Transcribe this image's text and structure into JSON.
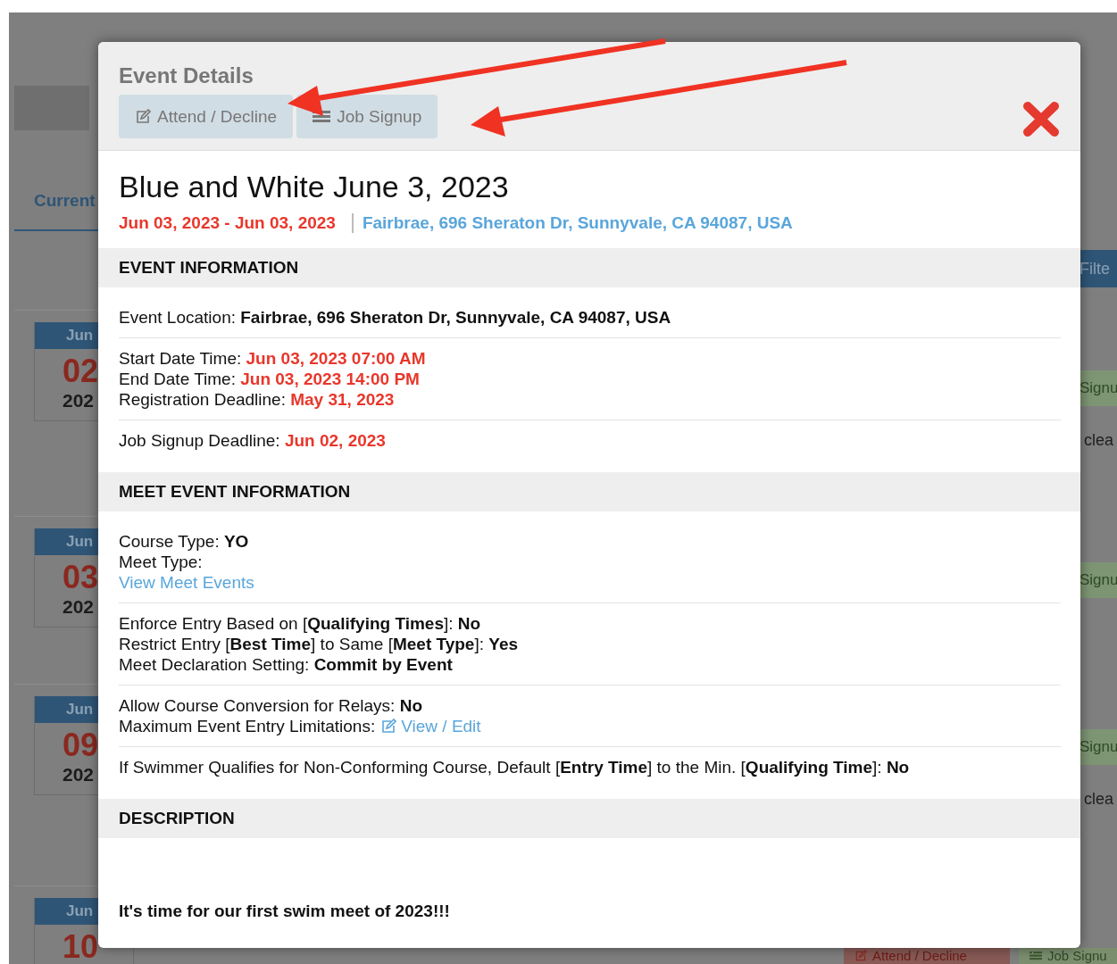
{
  "backdrop": {
    "tab": "Current",
    "filter_button": "Filte",
    "date_tiles": [
      {
        "month": "Jun",
        "day": "02",
        "year": "202"
      },
      {
        "month": "Jun",
        "day": "03",
        "year": "202"
      },
      {
        "month": "Jun",
        "day": "09",
        "year": "202"
      },
      {
        "month": "Jun",
        "day": "10"
      }
    ],
    "right_items": [
      {
        "kind": "badge",
        "text": "Signu"
      },
      {
        "kind": "text",
        "text": "clea"
      },
      {
        "kind": "badge",
        "text": "Signu"
      },
      {
        "kind": "badge",
        "text": "Signu"
      },
      {
        "kind": "text",
        "text": "clea"
      }
    ],
    "bottom_buttons": [
      {
        "label": "Attend / Decline",
        "kind": "edit"
      },
      {
        "label": "Job Signu",
        "kind": "list"
      }
    ]
  },
  "modal": {
    "title": "Event Details",
    "buttons": [
      {
        "label": "Attend / Decline",
        "kind": "edit"
      },
      {
        "label": "Job Signup",
        "kind": "list"
      }
    ],
    "event_name": "Blue and White June 3, 2023",
    "date_range": "Jun 03, 2023 - Jun 03, 2023",
    "location": "Fairbrae, 696 Sheraton Dr, Sunnyvale, CA 94087, USA",
    "sections": [
      {
        "heading": "EVENT INFORMATION",
        "groups": [
          [
            {
              "kind": "bold",
              "label": "Event Location:",
              "value": "Fairbrae, 696 Sheraton Dr, Sunnyvale, CA 94087, USA"
            }
          ],
          [
            {
              "kind": "date",
              "label": "Start Date Time:",
              "value": "Jun 03, 2023 07:00 AM"
            },
            {
              "kind": "date",
              "label": "End Date Time:",
              "value": "Jun 03, 2023 14:00 PM"
            },
            {
              "kind": "date",
              "label": "Registration Deadline:",
              "value": "May 31, 2023"
            }
          ],
          [
            {
              "kind": "date",
              "label": "Job Signup Deadline:",
              "value": "Jun 02, 2023"
            }
          ]
        ]
      },
      {
        "heading": "MEET EVENT INFORMATION",
        "groups": [
          [
            {
              "kind": "bold",
              "label": "Course Type:",
              "value": "YO"
            },
            {
              "kind": "plain",
              "label": "Meet Type:"
            },
            {
              "kind": "link",
              "value": "View Meet Events"
            }
          ],
          [
            {
              "kind": "rich",
              "text": "Enforce Entry Based on [**Qualifying Times**]: **No**"
            },
            {
              "kind": "rich",
              "text": "Restrict Entry [**Best Time**] to Same [**Meet Type**]: **Yes**"
            },
            {
              "kind": "bold",
              "label": "Meet Declaration Setting:",
              "value": "Commit by Event"
            }
          ],
          [
            {
              "kind": "bold",
              "label": "Allow Course Conversion for Relays:",
              "value": "No"
            },
            {
              "kind": "edit_link",
              "label": "Maximum Event Entry Limitations:",
              "value": "View / Edit"
            }
          ],
          [
            {
              "kind": "rich",
              "text": "If Swimmer Qualifies for Non-Conforming Course, Default [**Entry Time**] to the Min. [**Qualifying Time**]: **No**"
            }
          ]
        ]
      },
      {
        "heading": "DESCRIPTION",
        "description": "It's time for our first swim meet of 2023!!!"
      }
    ]
  }
}
